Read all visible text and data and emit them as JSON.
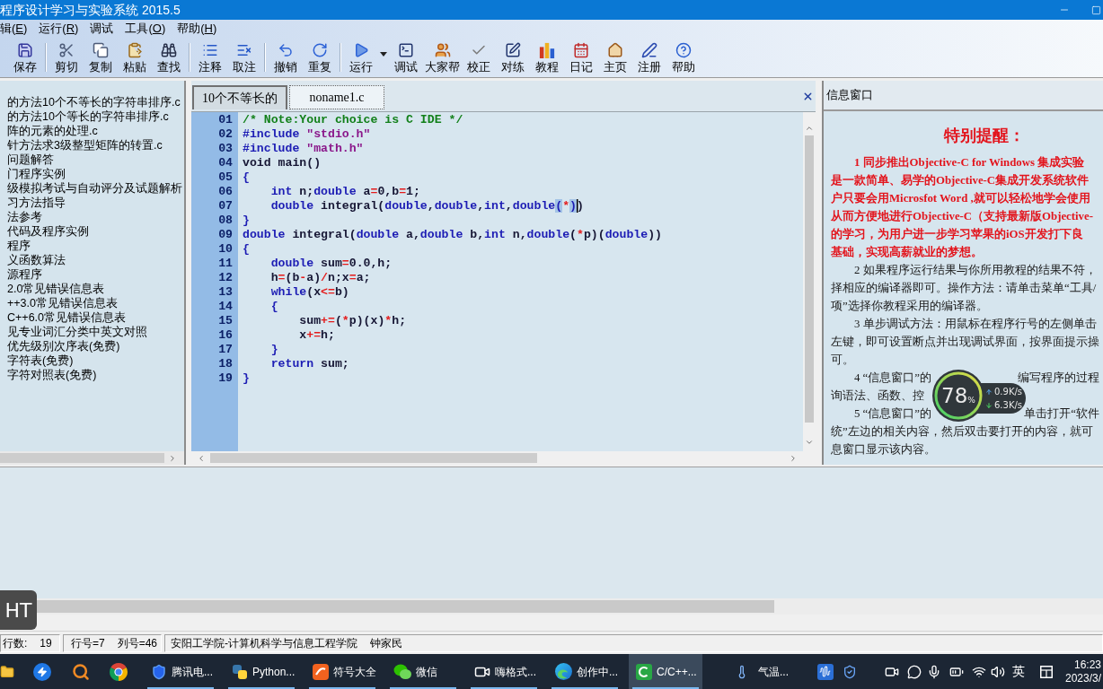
{
  "window": {
    "title": "程序设计学习与实验系统 2015.5"
  },
  "menu": [
    {
      "text": "辑(",
      "accel": "E",
      "text_after": ")"
    },
    {
      "text": "运行(",
      "accel": "R",
      "text_after": ")"
    },
    {
      "text": "调试"
    },
    {
      "text": "工具(",
      "accel": "O",
      "text_after": ")"
    },
    {
      "text": "帮助(",
      "accel": "H",
      "text_after": ")"
    }
  ],
  "toolbar": [
    [
      {
        "label": "保存",
        "kind": "save",
        "dropdown": false
      }
    ],
    [
      {
        "label": "剪切",
        "kind": "cut",
        "dropdown": false
      },
      {
        "label": "复制",
        "kind": "copy",
        "dropdown": false
      },
      {
        "label": "粘贴",
        "kind": "paste",
        "dropdown": false
      },
      {
        "label": "查找",
        "kind": "find",
        "dropdown": false
      }
    ],
    [
      {
        "label": "注释",
        "kind": "comment",
        "dropdown": false
      },
      {
        "label": "取注",
        "kind": "uncomment",
        "dropdown": false
      }
    ],
    [
      {
        "label": "撤销",
        "kind": "undo",
        "dropdown": false
      },
      {
        "label": "重复",
        "kind": "redo",
        "dropdown": false
      }
    ],
    [
      {
        "label": "运行",
        "kind": "run",
        "dropdown": true
      },
      {
        "label": "调试",
        "kind": "debug",
        "dropdown": false
      },
      {
        "label": "大家帮",
        "kind": "community",
        "dropdown": false
      },
      {
        "label": "校正",
        "kind": "check",
        "dropdown": false
      },
      {
        "label": "对练",
        "kind": "practice",
        "dropdown": false
      },
      {
        "label": "教程",
        "kind": "tutorial",
        "dropdown": false
      },
      {
        "label": "日记",
        "kind": "diary",
        "dropdown": false
      },
      {
        "label": "主页",
        "kind": "home",
        "dropdown": false
      },
      {
        "label": "注册",
        "kind": "register",
        "dropdown": false
      },
      {
        "label": "帮助",
        "kind": "help",
        "dropdown": false
      }
    ]
  ],
  "sidebar": {
    "items": [
      "的方法10个不等长的字符串排序.c",
      "的方法10个等长的字符串排序.c",
      "阵的元素的处理.c",
      "针方法求3级整型矩阵的转置.c",
      "问题解答",
      "门程序实例",
      "级模拟考试与自动评分及试题解析",
      "习方法指导",
      "法参考",
      "代码及程序实例",
      "程序",
      "义函数算法",
      "源程序",
      "2.0常见错误信息表",
      "++3.0常见错误信息表",
      "C++6.0常见错误信息表",
      "见专业词汇分类中英文对照",
      "优先级别次序表(免费)",
      "字符表(免费)",
      "字符对照表(免费)"
    ]
  },
  "editor": {
    "tabs": [
      {
        "label": "10个不等长的",
        "selected": false
      },
      {
        "label": "noname1.c",
        "selected": true
      }
    ],
    "lines": [
      {
        "number": "01",
        "caret": false,
        "tokens": [
          {
            "kind": "comment",
            "text": "/* Note:Your choice is C IDE */"
          }
        ]
      },
      {
        "number": "02",
        "caret": false,
        "tokens": [
          {
            "kind": "keyword",
            "text": "#include"
          },
          {
            "kind": "string",
            "text": " \"stdio.h\""
          }
        ]
      },
      {
        "number": "03",
        "caret": false,
        "tokens": [
          {
            "kind": "keyword",
            "text": "#include"
          },
          {
            "kind": "string",
            "text": " \"math.h\""
          }
        ]
      },
      {
        "number": "04",
        "caret": false,
        "tokens": [
          {
            "kind": "text",
            "text": "void main()"
          }
        ]
      },
      {
        "number": "05",
        "caret": false,
        "tokens": [
          {
            "kind": "brace",
            "text": "{"
          }
        ]
      },
      {
        "number": "06",
        "caret": false,
        "tokens": [
          {
            "kind": "keyword",
            "text": "    int"
          },
          {
            "kind": "text",
            "text": " n;"
          },
          {
            "kind": "keyword",
            "text": "double"
          },
          {
            "kind": "text",
            "text": " a"
          },
          {
            "kind": "op",
            "text": "="
          },
          {
            "kind": "text",
            "text": "0,b"
          },
          {
            "kind": "op",
            "text": "="
          },
          {
            "kind": "text",
            "text": "1;"
          }
        ]
      },
      {
        "number": "07",
        "caret": true,
        "tokens": [
          {
            "kind": "keyword",
            "text": "    double"
          },
          {
            "kind": "text",
            "text": " integral("
          },
          {
            "kind": "keyword",
            "text": "double"
          },
          {
            "kind": "text",
            "text": ","
          },
          {
            "kind": "keyword",
            "text": "double"
          },
          {
            "kind": "text",
            "text": ","
          },
          {
            "kind": "keyword",
            "text": "int"
          },
          {
            "kind": "text",
            "text": ","
          },
          {
            "kind": "keyword",
            "text": "double"
          },
          {
            "kind": "match",
            "text": "("
          },
          {
            "kind": "op",
            "text": "*"
          },
          {
            "kind": "match",
            "text": ")"
          },
          {
            "kind": "text",
            "text": ")"
          }
        ]
      },
      {
        "number": "08",
        "caret": false,
        "tokens": [
          {
            "kind": "brace",
            "text": "}"
          }
        ]
      },
      {
        "number": "09",
        "caret": false,
        "tokens": [
          {
            "kind": "keyword",
            "text": "double"
          },
          {
            "kind": "text",
            "text": " integral("
          },
          {
            "kind": "keyword",
            "text": "double"
          },
          {
            "kind": "text",
            "text": " a,"
          },
          {
            "kind": "keyword",
            "text": "double"
          },
          {
            "kind": "text",
            "text": " b,"
          },
          {
            "kind": "keyword",
            "text": "int"
          },
          {
            "kind": "text",
            "text": " n,"
          },
          {
            "kind": "keyword",
            "text": "double"
          },
          {
            "kind": "text",
            "text": "("
          },
          {
            "kind": "op",
            "text": "*"
          },
          {
            "kind": "text",
            "text": "p)("
          },
          {
            "kind": "keyword",
            "text": "double"
          },
          {
            "kind": "text",
            "text": "))"
          }
        ]
      },
      {
        "number": "10",
        "caret": false,
        "tokens": [
          {
            "kind": "brace",
            "text": "{"
          }
        ]
      },
      {
        "number": "11",
        "caret": false,
        "tokens": [
          {
            "kind": "keyword",
            "text": "    double"
          },
          {
            "kind": "text",
            "text": " sum"
          },
          {
            "kind": "op",
            "text": "="
          },
          {
            "kind": "text",
            "text": "0.0,h;"
          }
        ]
      },
      {
        "number": "12",
        "caret": false,
        "tokens": [
          {
            "kind": "text",
            "text": "    h"
          },
          {
            "kind": "op",
            "text": "="
          },
          {
            "kind": "text",
            "text": "(b"
          },
          {
            "kind": "op",
            "text": "-"
          },
          {
            "kind": "text",
            "text": "a)"
          },
          {
            "kind": "op",
            "text": "/"
          },
          {
            "kind": "text",
            "text": "n;x"
          },
          {
            "kind": "op",
            "text": "="
          },
          {
            "kind": "text",
            "text": "a;"
          }
        ]
      },
      {
        "number": "13",
        "caret": false,
        "tokens": [
          {
            "kind": "keyword",
            "text": "    while"
          },
          {
            "kind": "text",
            "text": "(x"
          },
          {
            "kind": "op",
            "text": "<="
          },
          {
            "kind": "text",
            "text": "b)"
          }
        ]
      },
      {
        "number": "14",
        "caret": false,
        "tokens": [
          {
            "kind": "brace",
            "text": "    {"
          }
        ]
      },
      {
        "number": "15",
        "caret": false,
        "tokens": [
          {
            "kind": "text",
            "text": "        sum"
          },
          {
            "kind": "op",
            "text": "+="
          },
          {
            "kind": "text",
            "text": "("
          },
          {
            "kind": "op",
            "text": "*"
          },
          {
            "kind": "text",
            "text": "p)(x)"
          },
          {
            "kind": "op",
            "text": "*"
          },
          {
            "kind": "text",
            "text": "h;"
          }
        ]
      },
      {
        "number": "16",
        "caret": false,
        "tokens": [
          {
            "kind": "text",
            "text": "        x"
          },
          {
            "kind": "op",
            "text": "+="
          },
          {
            "kind": "text",
            "text": "h;"
          }
        ]
      },
      {
        "number": "17",
        "caret": false,
        "tokens": [
          {
            "kind": "brace",
            "text": "    }"
          }
        ]
      },
      {
        "number": "18",
        "caret": false,
        "tokens": [
          {
            "kind": "keyword",
            "text": "    return"
          },
          {
            "kind": "text",
            "text": " sum;"
          }
        ]
      },
      {
        "number": "19",
        "caret": false,
        "tokens": [
          {
            "kind": "brace",
            "text": "}"
          }
        ]
      }
    ]
  },
  "info_panel": {
    "title": "信息窗口",
    "heading": "特别提醒：",
    "paragraphs": [
      {
        "kind": "notice",
        "lines": [
          {
            "text": "1 同步推出Objective-C for Windows 集成实验"
          },
          {
            "text": "是一款简单、易学的Objective-C集成开发系统软件"
          },
          {
            "text": "户只要会用Microsfot Word ,就可以轻松地学会使用"
          },
          {
            "text": "从而方便地进行Objective-C（支持最新版Objective-"
          },
          {
            "text": "的学习，为用户进一步学习苹果的iOS开发打下良"
          },
          {
            "text": "基础，实现高薪就业的梦想。"
          }
        ]
      },
      {
        "kind": "normal",
        "lines": [
          {
            "text": "2 如果程序运行结果与你所用教程的结果不符，"
          },
          {
            "text": "择相应的编译器即可。操作方法：请单击菜单“工具/"
          },
          {
            "text": "项”选择你教程采用的编译器。"
          }
        ]
      },
      {
        "kind": "normal",
        "lines": [
          {
            "text": "3 单步调试方法：用鼠标在程序行号的左侧单击"
          },
          {
            "text": "左键，即可设置断点并出现调试界面，按界面提示操"
          },
          {
            "text": "可。"
          }
        ]
      },
      {
        "kind": "normal",
        "lines": [
          {
            "text": "4 “信息窗口”的",
            "text_after_overlay": "编写程序的过程"
          },
          {
            "text": "询语法、函数、控"
          }
        ]
      },
      {
        "kind": "normal",
        "lines": [
          {
            "text": "5 “信息窗口”的",
            "text_after_overlay": "单击打开“软件"
          },
          {
            "text": "统”左边的相关内容，然后双击要打开的内容，就可"
          },
          {
            "text": "息窗口显示该内容。"
          }
        ]
      }
    ]
  },
  "net_monitor": {
    "percent": "78",
    "unit": "%",
    "upload": "0.9K/s",
    "download": "6.3K/s"
  },
  "overlay_badge": "HT",
  "status_bar": [
    [
      "行数:",
      "19"
    ],
    [
      "行号=7",
      "列号=46"
    ],
    [
      "安阳工学院-计算机科学与信息工程学院",
      "钟家民"
    ]
  ],
  "taskbar": {
    "apps": [
      {
        "kind": "shield",
        "label": "腾讯电...",
        "running": true,
        "selected": false
      },
      {
        "kind": "python",
        "label": "Python...",
        "running": true,
        "selected": false
      },
      {
        "kind": "logo_tile",
        "label": "符号大全",
        "running": true,
        "selected": false
      },
      {
        "kind": "chat",
        "label": "微信",
        "running": true,
        "selected": false
      },
      {
        "kind": "camera",
        "label": "嗨格式...",
        "running": true,
        "selected": false
      },
      {
        "kind": "browser",
        "label": "创作中...",
        "running": true,
        "selected": false
      },
      {
        "kind": "ide",
        "label": "C/C++...",
        "running": true,
        "selected": true
      }
    ],
    "weather": "气温...",
    "ime": "英",
    "clock": {
      "time": "16:23",
      "date": "2023/3/"
    }
  }
}
